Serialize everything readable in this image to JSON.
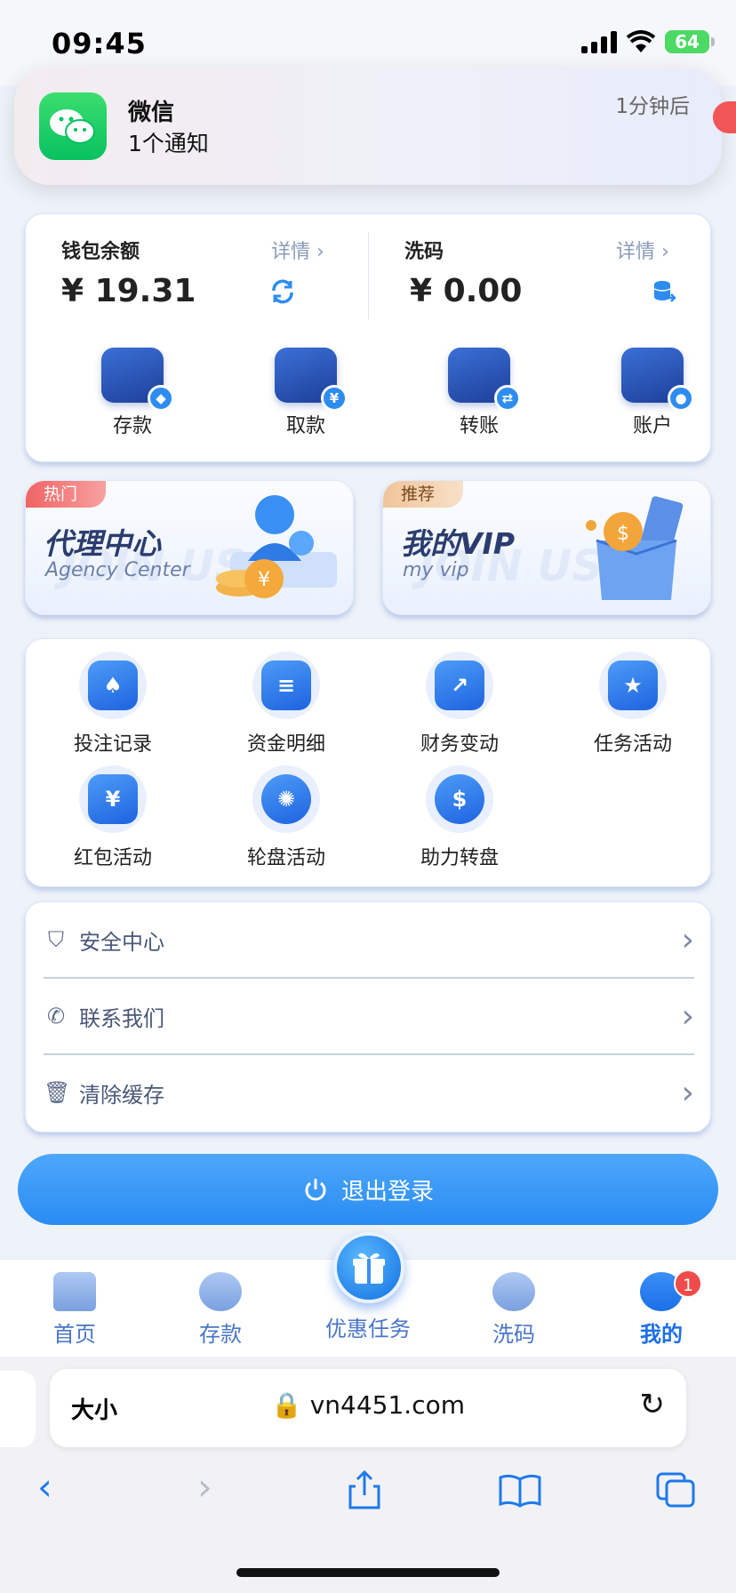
{
  "status_bar": {
    "time": "09:45",
    "battery": "64"
  },
  "notification": {
    "app": "微信",
    "body": "1个通知",
    "time": "1分钟后"
  },
  "wallet": {
    "balance_label": "钱包余额",
    "balance_detail": "详情 ›",
    "balance_amount": "¥ 19.31",
    "wash_label": "洗码",
    "wash_detail": "详情 ›",
    "wash_amount": "¥ 0.00",
    "actions": [
      {
        "label": "存款",
        "badge": "◆"
      },
      {
        "label": "取款",
        "badge": "¥"
      },
      {
        "label": "转账",
        "badge": "⇄"
      },
      {
        "label": "账户",
        "badge": "●"
      }
    ]
  },
  "promos": [
    {
      "tag": "热门",
      "title": "代理中心",
      "subtitle": "Agency Center",
      "watermark": "JOIN US"
    },
    {
      "tag": "推荐",
      "title": "我的VIP",
      "subtitle": "my vip",
      "watermark": "JOIN US"
    }
  ],
  "features": [
    {
      "label": "投注记录",
      "glyph": "♠"
    },
    {
      "label": "资金明细",
      "glyph": "≡"
    },
    {
      "label": "财务变动",
      "glyph": "↗"
    },
    {
      "label": "任务活动",
      "glyph": "★"
    },
    {
      "label": "红包活动",
      "glyph": "¥"
    },
    {
      "label": "轮盘活动",
      "glyph": "✺"
    },
    {
      "label": "助力转盘",
      "glyph": "$"
    }
  ],
  "menu": [
    {
      "label": "安全中心",
      "icon": "shield-icon",
      "glyph": "⛉"
    },
    {
      "label": "联系我们",
      "icon": "phone-icon",
      "glyph": "✆"
    },
    {
      "label": "清除缓存",
      "icon": "trash-icon",
      "glyph": "🗑"
    }
  ],
  "logout_label": "退出登录",
  "tabs": [
    {
      "label": "首页"
    },
    {
      "label": "存款"
    },
    {
      "label": "优惠任务"
    },
    {
      "label": "洗码"
    },
    {
      "label": "我的"
    }
  ],
  "tab_badge": "1",
  "browser": {
    "text_size": "大小",
    "url": "🔒 vn4451.com"
  }
}
